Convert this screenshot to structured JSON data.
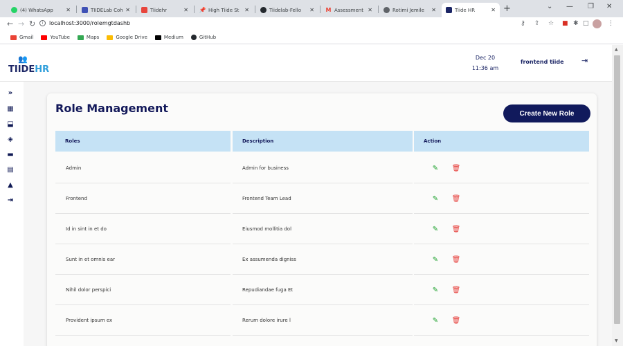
{
  "browser": {
    "tabs": [
      {
        "label": "(4) WhatsApp",
        "icon": "whatsapp-icon",
        "color": "#25d366"
      },
      {
        "label": "TIIDELab Coh",
        "icon": "tiidelab-icon",
        "color": "#3f51b5"
      },
      {
        "label": "Tiidehr",
        "icon": "tiidehr-icon",
        "color": "#e8453c"
      },
      {
        "label": "High Tiide St",
        "icon": "pin-icon",
        "color": "#d93025"
      },
      {
        "label": "Tiidelab-Fello",
        "icon": "github-icon",
        "color": "#24292e"
      },
      {
        "label": "Assessment",
        "icon": "gmail-icon",
        "color": "#ea4335"
      },
      {
        "label": "Rotimi Jemile",
        "icon": "globe-icon",
        "color": "#5f6368"
      },
      {
        "label": "Tiide HR",
        "icon": "tiide-hr-favicon",
        "color": "#1b2565"
      }
    ],
    "url": "localhost:3000/rolemgtdashb",
    "bookmarks": [
      {
        "label": "Gmail",
        "color": "#ea4335"
      },
      {
        "label": "YouTube",
        "color": "#ff0000"
      },
      {
        "label": "Maps",
        "color": "#34a853"
      },
      {
        "label": "Google Drive",
        "color": "#fbbc04"
      },
      {
        "label": "Medium",
        "color": "#000000"
      },
      {
        "label": "GitHub",
        "color": "#24292e"
      }
    ]
  },
  "header": {
    "logo_text": "TIIDE",
    "logo_hr": "HR",
    "date": "Dec 20",
    "time": "11:36 am",
    "username": "frontend tiide"
  },
  "sidebar": {
    "icons": [
      "chevrons-right-icon",
      "table-icon",
      "briefcase-icon",
      "layers-icon",
      "bed-icon",
      "id-card-icon",
      "bell-icon",
      "logout-icon"
    ]
  },
  "page": {
    "title": "Role Management",
    "create_button": "Create New Role"
  },
  "table": {
    "headers": [
      "Roles",
      "Description",
      "Action"
    ],
    "rows": [
      {
        "role": "Admin",
        "description": "Admin for business"
      },
      {
        "role": "Frontend",
        "description": "Frontend Team Lead"
      },
      {
        "role": "Id in sint in et do",
        "description": "Eiusmod mollitia dol"
      },
      {
        "role": "Sunt in et omnis ear",
        "description": "Ex assumenda digniss"
      },
      {
        "role": "Nihil dolor perspici",
        "description": "Repudiandae fuga Et"
      },
      {
        "role": "Provident ipsum ex",
        "description": "Rerum dolore irure l"
      }
    ]
  },
  "colors": {
    "brand_navy": "#111a5c",
    "header_row": "#c5e2f5",
    "edit_green": "#1ca02c",
    "delete_red": "#e53935",
    "logo_hr_blue": "#2f9fdb"
  }
}
